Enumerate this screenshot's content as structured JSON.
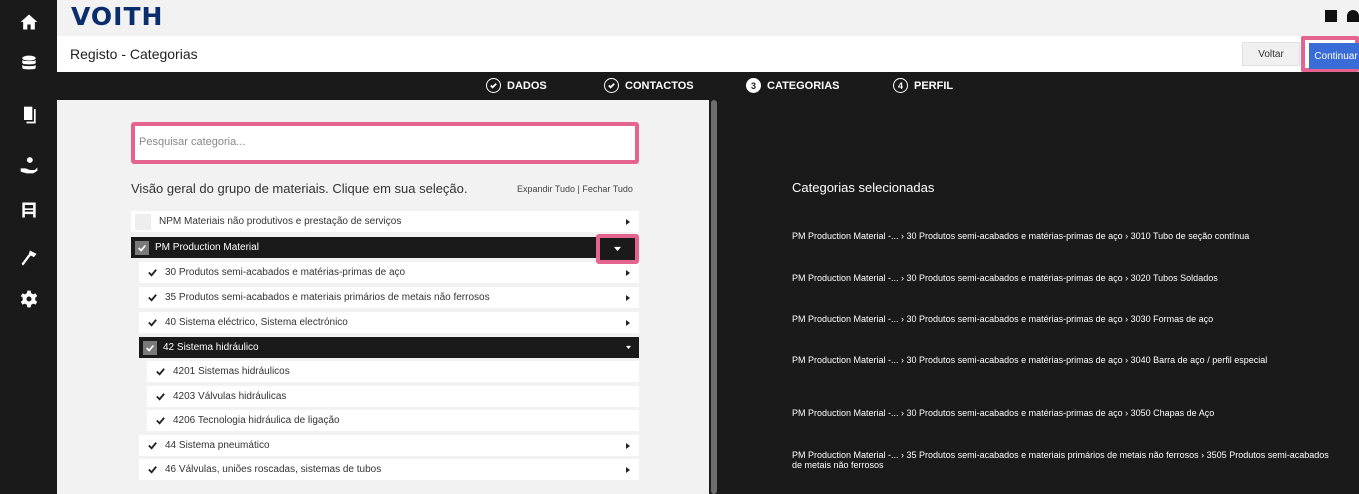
{
  "header": {
    "logo": "VOITH",
    "page_title": "Registo - Categorias",
    "voltar_label": "Voltar",
    "continuar_label": "Continuar"
  },
  "rail_icons": [
    "home-icon",
    "database-icon",
    "documents-icon",
    "hand-user-icon",
    "building-icon",
    "hammer-icon",
    "gear-icon"
  ],
  "steps": [
    {
      "label": "DADOS",
      "marker": "check",
      "state": "done"
    },
    {
      "label": "CONTACTOS",
      "marker": "check",
      "state": "done"
    },
    {
      "label": "CATEGORIAS",
      "marker": "3",
      "state": "active"
    },
    {
      "label": "PERFIL",
      "marker": "4",
      "state": "pending"
    }
  ],
  "left": {
    "search_placeholder": "Pesquisar categoria...",
    "overview_text": "Visão geral do grupo de materiais. Clique em sua seleção.",
    "expand_links": "Expandir Tudo | Fechar Tudo",
    "tree": [
      {
        "label": "NPM Materiais não produtivos e prestação de serviços",
        "level": 0,
        "checked": false,
        "dark": false,
        "arrow": "right"
      },
      {
        "label": "PM Production Material",
        "level": 0,
        "checked": true,
        "dark": true,
        "arrow": "down"
      },
      {
        "label": "30 Produtos semi-acabados e matérias-primas de aço",
        "level": 1,
        "checked": true,
        "dark": false,
        "arrow": "right"
      },
      {
        "label": "35 Produtos semi-acabados e materiais primários de metais não ferrosos",
        "level": 1,
        "checked": true,
        "dark": false,
        "arrow": "right"
      },
      {
        "label": "40 Sistema eléctrico, Sistema electrónico",
        "level": 1,
        "checked": true,
        "dark": false,
        "arrow": "right"
      },
      {
        "label": "42 Sistema hidráulico",
        "level": 1,
        "checked": true,
        "dark": true,
        "arrow": "down"
      },
      {
        "label": "4201 Sistemas hidráulicos",
        "level": 2,
        "checked": true,
        "dark": false,
        "arrow": ""
      },
      {
        "label": "4203 Válvulas hidráulicas",
        "level": 2,
        "checked": true,
        "dark": false,
        "arrow": ""
      },
      {
        "label": "4206 Tecnologia hidráulica de ligação",
        "level": 2,
        "checked": true,
        "dark": false,
        "arrow": ""
      },
      {
        "label": "44 Sistema pneumático",
        "level": 1,
        "checked": true,
        "dark": false,
        "arrow": "right"
      },
      {
        "label": "46 Válvulas, uniões roscadas, sistemas de tubos",
        "level": 1,
        "checked": true,
        "dark": false,
        "arrow": "right"
      }
    ]
  },
  "right": {
    "title": "Categorias selecionadas",
    "items": [
      "PM Production Material -... › 30 Produtos semi-acabados e matérias-primas de aço › 3010 Tubo de seção contínua",
      "PM Production Material -... › 30 Produtos semi-acabados e matérias-primas de aço › 3020 Tubos Soldados",
      "PM Production Material -... › 30 Produtos semi-acabados e matérias-primas de aço › 3030 Formas de aço",
      "PM Production Material -... › 30 Produtos semi-acabados e matérias-primas de aço › 3040 Barra de aço / perfil especial",
      "PM Production Material -... › 30 Produtos semi-acabados e matérias-primas de aço › 3050 Chapas de Aço",
      "PM Production Material -... › 35 Produtos semi-acabados e materiais primários de metais não ferrosos › 3505 Produtos semi-acabados de metais não ferrosos"
    ]
  },
  "colors": {
    "dark": "#1a1a1a",
    "highlight": "#e5648f",
    "primary_button": "#3a6cd8",
    "logo": "#0a2d6e"
  }
}
